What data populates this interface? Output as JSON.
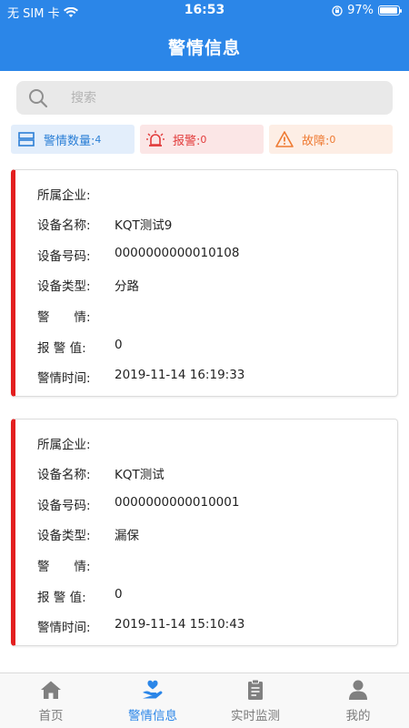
{
  "status_bar": {
    "carrier": "无 SIM 卡",
    "time": "16:53",
    "battery": "97%",
    "battery_level": 0.97
  },
  "header": {
    "title": "警情信息"
  },
  "search": {
    "placeholder": "搜索",
    "value": ""
  },
  "stats": {
    "alarm_count_label": "警情数量:",
    "alarm_count_value": "4",
    "alarm_label": "报警:",
    "alarm_value": "0",
    "fault_label": "故障:",
    "fault_value": "0"
  },
  "colors": {
    "primary": "#2b86e8",
    "alarm_red": "#e31f1f",
    "fault_orange": "#ee7a32"
  },
  "labels": {
    "company": "所属企业:",
    "device_name": "设备名称:",
    "device_code": "设备号码:",
    "device_type": "设备类型:",
    "alarm_info": "警　　情:",
    "alarm_value": "报 警 值:",
    "alarm_time": "警情时间:"
  },
  "records": [
    {
      "company": "",
      "device_name": "KQT测试9",
      "device_code": "0000000000010108",
      "device_type": "分路",
      "alarm_info": "",
      "alarm_value": "0",
      "alarm_time": "2019-11-14 16:19:33"
    },
    {
      "company": "",
      "device_name": "KQT测试",
      "device_code": "0000000000010001",
      "device_type": "漏保",
      "alarm_info": "",
      "alarm_value": "0",
      "alarm_time": "2019-11-14 15:10:43"
    }
  ],
  "tabbar": {
    "home": "首页",
    "alarm_info": "警情信息",
    "monitor": "实时监测",
    "mine": "我的",
    "active": "alarm_info"
  }
}
